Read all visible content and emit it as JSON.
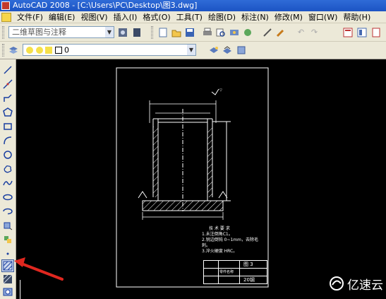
{
  "window": {
    "title": "AutoCAD 2008 - [C:\\Users\\PC\\Desktop\\图3.dwg]"
  },
  "menu": [
    "文件(F)",
    "编辑(E)",
    "视图(V)",
    "插入(I)",
    "格式(O)",
    "工具(T)",
    "绘图(D)",
    "标注(N)",
    "修改(M)",
    "窗口(W)",
    "帮助(H)"
  ],
  "toolbar": {
    "workspace": "二维草图与注释",
    "layer": "0"
  },
  "drawing": {
    "tech_req_title": "技 术 要 求",
    "tech_req": [
      "1.未注倒角C1。",
      "2.锐边倒钝 0~1mm，去除毛刺。",
      "3.淬火硬度 HRC。"
    ],
    "title_block": {
      "name": "零件名称",
      "sheet": "图 3",
      "material": "20钢"
    }
  },
  "watermark": {
    "text": "亿速云"
  }
}
